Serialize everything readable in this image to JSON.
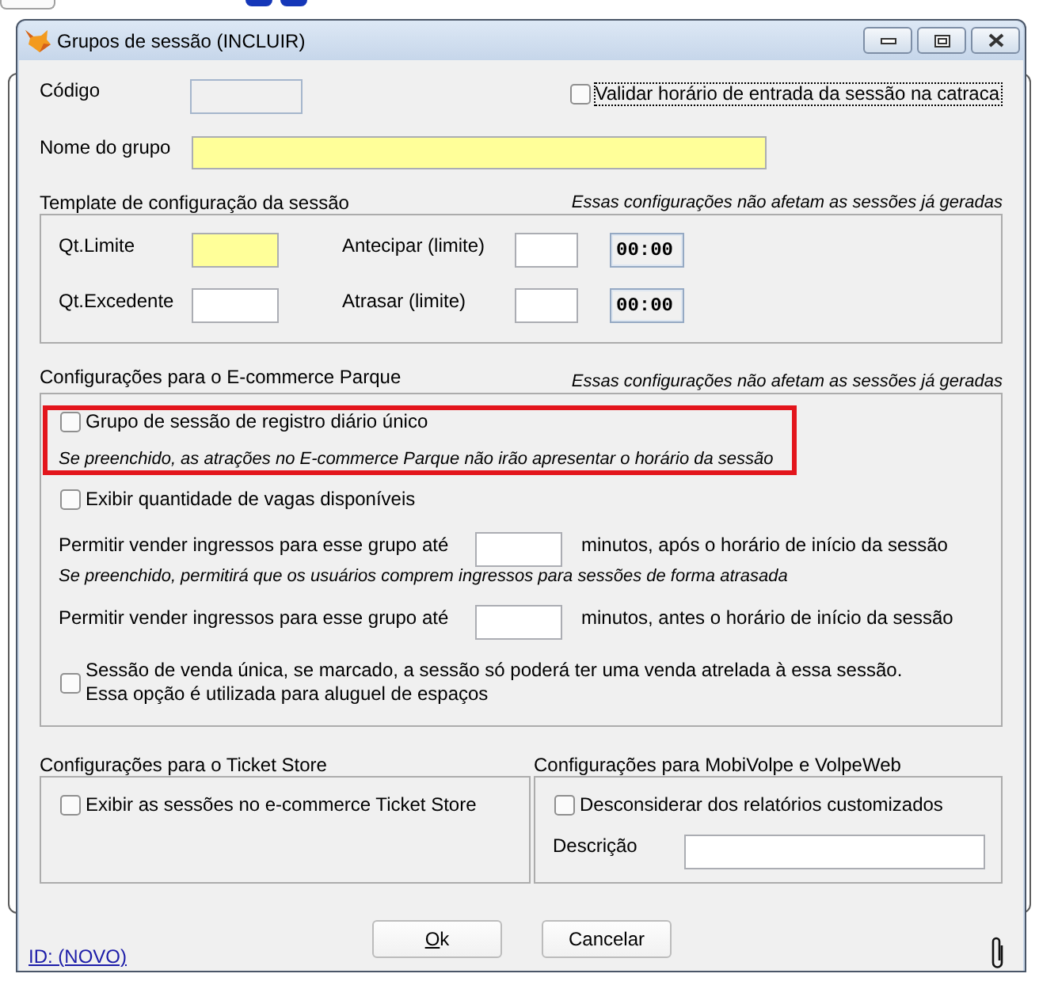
{
  "window": {
    "title": "Grupos de sessão (INCLUIR)"
  },
  "code_field": {
    "label": "Código",
    "disabled": true
  },
  "validate_option": {
    "label": "Validar horário de entrada da sessão na catraca",
    "checked": false,
    "focused": true
  },
  "name_field": {
    "label": "Nome do grupo",
    "required": true
  },
  "template": {
    "title": "Template de configuração da sessão",
    "note": "Essas configurações não afetam as sessões já geradas",
    "rows": [
      {
        "label": "Qt.Limite",
        "required": true,
        "limit_label": "Antecipar (limite)",
        "time": "00:00"
      },
      {
        "label": "Qt.Excedente",
        "required": false,
        "limit_label": "Atrasar (limite)",
        "time": "00:00"
      }
    ]
  },
  "ecommerce": {
    "title": "Configurações para o E-commerce Parque",
    "note": "Essas configurações não afetam as sessões já geradas",
    "items": [
      {
        "kind": "checkbox",
        "label": "Grupo de sessão de registro diário único",
        "checked": false,
        "highlighted": true,
        "note": "Se preenchido, as atrações no E-commerce Parque não irão apresentar o horário da sessão"
      },
      {
        "kind": "checkbox",
        "label": "Exibir quantidade de vagas disponíveis",
        "checked": false,
        "highlighted": false
      },
      {
        "kind": "minutes",
        "label": "Permitir vender ingressos para esse grupo até",
        "suffix": "minutos, após o horário de início da sessão",
        "highlighted": false,
        "note": "Se preenchido, permitirá que os usuários comprem ingressos para sessões de forma atrasada"
      },
      {
        "kind": "minutes",
        "label": "Permitir vender ingressos para esse grupo até",
        "suffix": "minutos, antes o horário de início da sessão",
        "highlighted": false
      },
      {
        "kind": "checkbox",
        "label": "Sessão de venda única, se marcado, a sessão só poderá ter uma venda atrelada à essa sessão.\nEssa opção é utilizada para aluguel de espaços",
        "checked": false,
        "highlighted": false
      }
    ]
  },
  "ticket_store": {
    "title": "Configurações para o Ticket Store",
    "options": [
      {
        "label": "Exibir as sessões no e-commerce Ticket Store",
        "checked": false
      }
    ]
  },
  "mobile_web": {
    "title": "Configurações para MobiVolpe e VolpeWeb",
    "options": [
      {
        "label": "Desconsiderar dos relatórios customizados",
        "checked": false
      }
    ],
    "description_label": "Descrição"
  },
  "buttons": [
    {
      "label": "Ok",
      "mnemonic": true
    },
    {
      "label": "Cancelar",
      "mnemonic": false
    }
  ],
  "record_link": "ID: (NOVO)"
}
